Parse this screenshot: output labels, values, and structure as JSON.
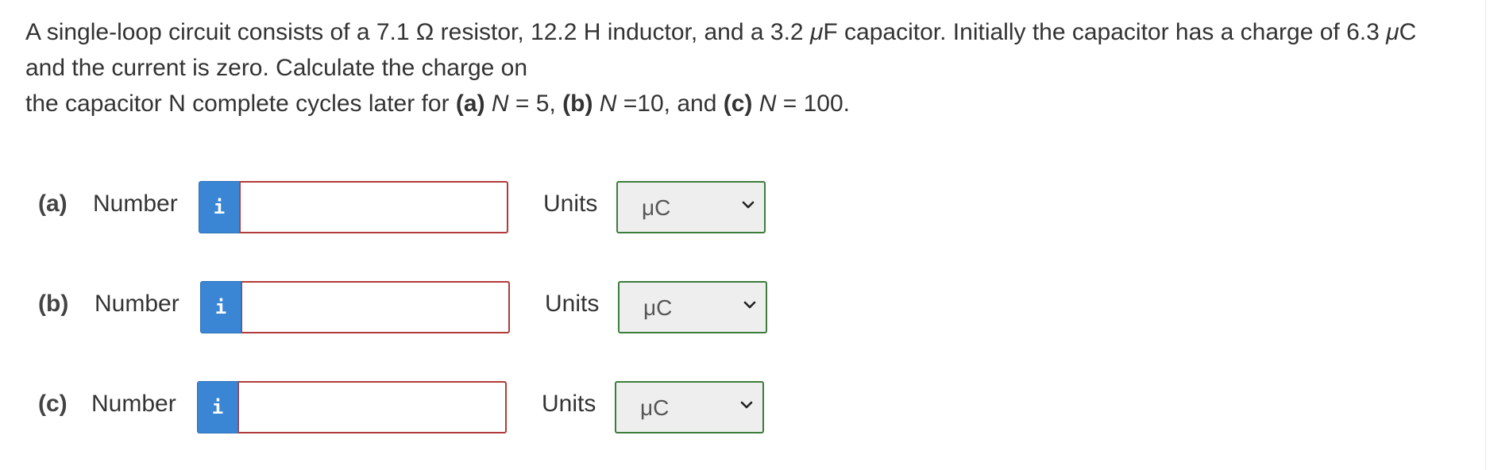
{
  "question": {
    "line1_a": "A single-loop circuit consists of a 7.1 Ω resistor, 12.2 H inductor, and a 3.2 ",
    "line1_mu1": "μ",
    "line1_b": "F capacitor. Initially the capacitor has a charge of 6.3 ",
    "line1_mu2": "μ",
    "line1_c": "C",
    "line2": "and the current is zero. Calculate the charge on",
    "line3_a": "the capacitor N complete cycles later for ",
    "line3_pa": "(a)",
    "line3_na": "N",
    "line3_va": " = 5, ",
    "line3_pb": "(b)",
    "line3_nb": "N",
    "line3_vb": " =10, and ",
    "line3_pc": "(c)",
    "line3_nc": "N",
    "line3_vc": " = 100."
  },
  "parts": [
    {
      "label": "(a)",
      "number_label": "Number",
      "info_icon": "i",
      "value": "",
      "units_label": "Units",
      "units_value": "μC"
    },
    {
      "label": "(b)",
      "number_label": "Number",
      "info_icon": "i",
      "value": "",
      "units_label": "Units",
      "units_value": "μC"
    },
    {
      "label": "(c)",
      "number_label": "Number",
      "info_icon": "i",
      "value": "",
      "units_label": "Units",
      "units_value": "μC"
    }
  ],
  "colors": {
    "info_button": "#3a86d4",
    "input_border": "#b23a3a",
    "select_border": "#3c7d3c",
    "select_bg": "#eeeeee"
  },
  "icons": {
    "info": "info-icon",
    "dropdown": "chevron-down-icon"
  }
}
